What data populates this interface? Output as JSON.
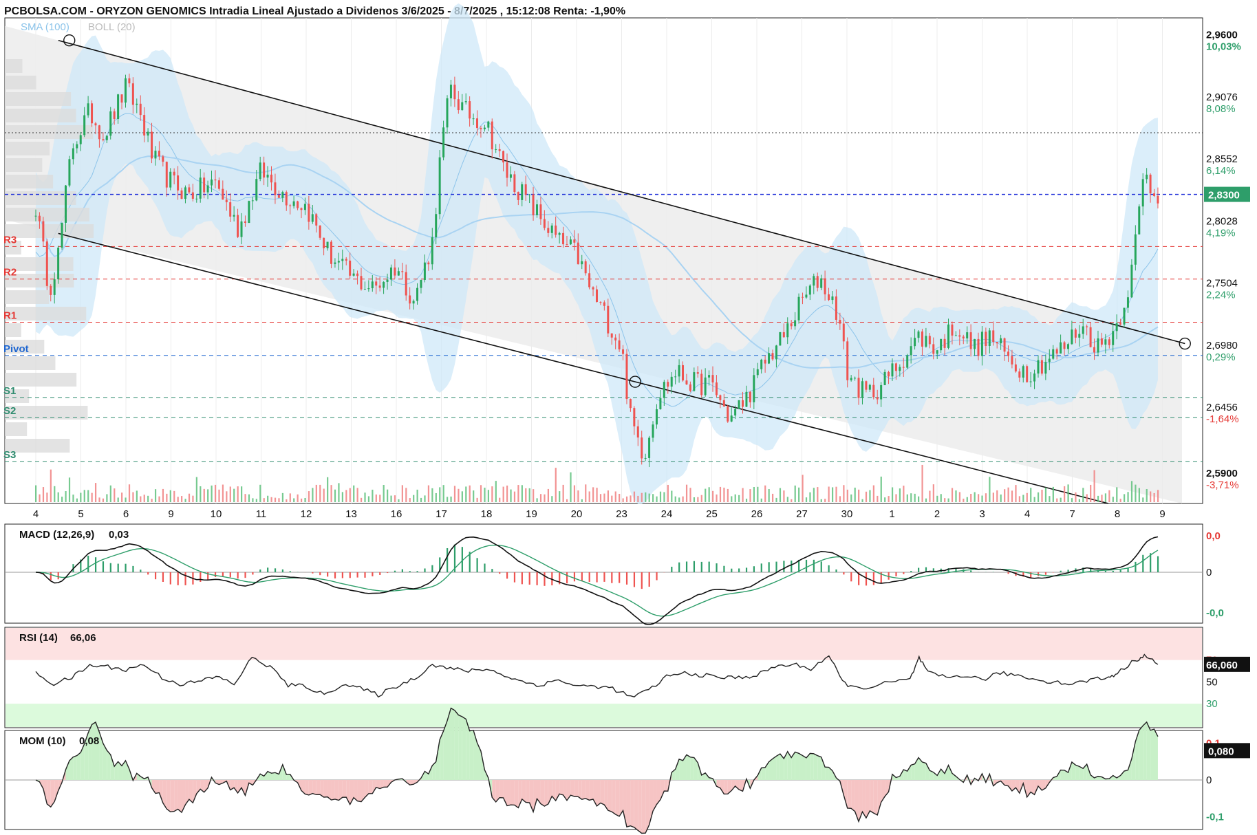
{
  "header": {
    "title": "PCBOLSA.COM - ORYZON GENOMICS Intradia Lineal Ajustado a Dividenos 3/6/2025 - 8/7/2025 , 15:12:08 Renta: -1,90%"
  },
  "indicators_legend": {
    "sma": "SMA (100)",
    "boll": "BOLL (20)"
  },
  "colors": {
    "up": "#26a65b",
    "down": "#ef5350",
    "pivot": "#1e66d0",
    "support": "#2e8b6e",
    "resistance": "#e53935",
    "band": "#cfe8f8",
    "channel": "#e8e8e8"
  },
  "chart_data": [
    {
      "type": "candlestick",
      "name": "main",
      "x_ticks": [
        "4",
        "5",
        "6",
        "9",
        "10",
        "11",
        "12",
        "13",
        "16",
        "17",
        "18",
        "19",
        "20",
        "23",
        "24",
        "25",
        "26",
        "27",
        "30",
        "1",
        "2",
        "3",
        "4",
        "7",
        "8",
        "9"
      ],
      "y_ticks": [
        {
          "value": 2.96,
          "label": "2,9600",
          "pct": "10,03%"
        },
        {
          "value": 2.9076,
          "label": "2,9076",
          "pct": "8,08%"
        },
        {
          "value": 2.8552,
          "label": "2,8552",
          "pct": "6,14%"
        },
        {
          "value": 2.8028,
          "label": "2,8028",
          "pct": "4,19%"
        },
        {
          "value": 2.7504,
          "label": "2,7504",
          "pct": "2,24%"
        },
        {
          "value": 2.698,
          "label": "2,6980",
          "pct": "0,29%"
        },
        {
          "value": 2.6456,
          "label": "2,6456",
          "pct": "-1,64%"
        },
        {
          "value": 2.59,
          "label": "2,5900",
          "pct": "-3,71%"
        }
      ],
      "ylim": [
        2.569,
        2.979
      ],
      "last_price": {
        "value": 2.83,
        "label": "2,8300"
      },
      "pivot_levels": [
        {
          "name": "R3",
          "value": 2.786
        },
        {
          "name": "R2",
          "value": 2.7585
        },
        {
          "name": "R1",
          "value": 2.722
        },
        {
          "name": "Pivot",
          "value": 2.694
        },
        {
          "name": "S1",
          "value": 2.6585
        },
        {
          "name": "S2",
          "value": 2.6415
        },
        {
          "name": "S3",
          "value": 2.6045
        }
      ],
      "reference_line": 2.882,
      "channel": {
        "upper": [
          [
            0.5,
            2.96
          ],
          [
            25.5,
            2.704
          ]
        ],
        "lower": [
          [
            0.5,
            2.797
          ],
          [
            23.8,
            2.569
          ]
        ]
      },
      "price_path": [
        [
          0,
          2.82
        ],
        [
          0.3,
          2.75
        ],
        [
          0.5,
          2.78
        ],
        [
          0.8,
          2.87
        ],
        [
          1.2,
          2.9
        ],
        [
          1.5,
          2.88
        ],
        [
          2.0,
          2.92
        ],
        [
          2.3,
          2.9
        ],
        [
          2.6,
          2.86
        ],
        [
          3.0,
          2.84
        ],
        [
          3.4,
          2.83
        ],
        [
          4.0,
          2.84
        ],
        [
          4.5,
          2.8
        ],
        [
          5.0,
          2.85
        ],
        [
          5.5,
          2.83
        ],
        [
          6.0,
          2.82
        ],
        [
          6.5,
          2.78
        ],
        [
          7.0,
          2.76
        ],
        [
          7.5,
          2.75
        ],
        [
          8.0,
          2.77
        ],
        [
          8.4,
          2.74
        ],
        [
          8.8,
          2.79
        ],
        [
          9.0,
          2.87
        ],
        [
          9.2,
          2.92
        ],
        [
          9.5,
          2.9
        ],
        [
          10.0,
          2.89
        ],
        [
          10.4,
          2.85
        ],
        [
          10.8,
          2.83
        ],
        [
          11.2,
          2.81
        ],
        [
          11.6,
          2.79
        ],
        [
          12.0,
          2.78
        ],
        [
          12.3,
          2.75
        ],
        [
          12.6,
          2.73
        ],
        [
          13.0,
          2.7
        ],
        [
          13.2,
          2.64
        ],
        [
          13.5,
          2.61
        ],
        [
          13.8,
          2.66
        ],
        [
          14.2,
          2.68
        ],
        [
          14.6,
          2.67
        ],
        [
          15.0,
          2.67
        ],
        [
          15.4,
          2.64
        ],
        [
          15.8,
          2.66
        ],
        [
          16.2,
          2.69
        ],
        [
          16.6,
          2.71
        ],
        [
          17.0,
          2.74
        ],
        [
          17.4,
          2.76
        ],
        [
          17.8,
          2.73
        ],
        [
          18.0,
          2.68
        ],
        [
          18.4,
          2.66
        ],
        [
          18.8,
          2.67
        ],
        [
          19.2,
          2.69
        ],
        [
          19.6,
          2.71
        ],
        [
          20.0,
          2.7
        ],
        [
          20.4,
          2.72
        ],
        [
          20.8,
          2.7
        ],
        [
          21.2,
          2.71
        ],
        [
          21.6,
          2.69
        ],
        [
          22.0,
          2.68
        ],
        [
          22.4,
          2.69
        ],
        [
          22.8,
          2.7
        ],
        [
          23.2,
          2.72
        ],
        [
          23.6,
          2.7
        ],
        [
          24.0,
          2.72
        ],
        [
          24.3,
          2.76
        ],
        [
          24.6,
          2.85
        ],
        [
          24.8,
          2.83
        ]
      ]
    },
    {
      "type": "line",
      "name": "MACD",
      "label": "MACD (12,26,9)",
      "value": "0,03",
      "y_ticks": [
        "0,0",
        "0",
        "-0,0"
      ]
    },
    {
      "type": "line",
      "name": "RSI",
      "label": "RSI (14)",
      "value": "66,06",
      "current": {
        "value": 66.06,
        "label": "66,060"
      },
      "y_ticks": [
        {
          "value": 70,
          "label": "70"
        },
        {
          "value": 50,
          "label": "50"
        },
        {
          "value": 30,
          "label": "30"
        }
      ],
      "ylim": [
        8,
        100
      ],
      "points": [
        [
          0,
          58
        ],
        [
          0.4,
          48
        ],
        [
          0.8,
          54
        ],
        [
          1.2,
          65
        ],
        [
          1.6,
          64
        ],
        [
          2.0,
          61
        ],
        [
          2.4,
          66
        ],
        [
          2.8,
          54
        ],
        [
          3.2,
          48
        ],
        [
          3.6,
          50
        ],
        [
          4.0,
          55
        ],
        [
          4.4,
          48
        ],
        [
          4.8,
          72
        ],
        [
          5.2,
          64
        ],
        [
          5.6,
          47
        ],
        [
          6.0,
          46
        ],
        [
          6.4,
          38
        ],
        [
          6.8,
          48
        ],
        [
          7.2,
          44
        ],
        [
          7.6,
          38
        ],
        [
          8.0,
          46
        ],
        [
          8.4,
          53
        ],
        [
          8.8,
          66
        ],
        [
          9.2,
          62
        ],
        [
          9.6,
          60
        ],
        [
          10.0,
          62
        ],
        [
          10.4,
          56
        ],
        [
          10.8,
          50
        ],
        [
          11.2,
          47
        ],
        [
          11.6,
          52
        ],
        [
          12.0,
          46
        ],
        [
          12.4,
          46
        ],
        [
          12.8,
          44
        ],
        [
          13.2,
          36
        ],
        [
          13.6,
          42
        ],
        [
          14.0,
          55
        ],
        [
          14.4,
          58
        ],
        [
          14.8,
          56
        ],
        [
          15.2,
          54
        ],
        [
          15.6,
          54
        ],
        [
          16.0,
          56
        ],
        [
          16.4,
          64
        ],
        [
          16.8,
          66
        ],
        [
          17.2,
          62
        ],
        [
          17.6,
          74
        ],
        [
          17.9,
          50
        ],
        [
          18.2,
          44
        ],
        [
          18.6,
          46
        ],
        [
          19.0,
          50
        ],
        [
          19.4,
          52
        ],
        [
          19.6,
          72
        ],
        [
          19.8,
          58
        ],
        [
          20.2,
          54
        ],
        [
          20.6,
          56
        ],
        [
          21.0,
          52
        ],
        [
          21.4,
          58
        ],
        [
          21.8,
          56
        ],
        [
          22.2,
          52
        ],
        [
          22.6,
          50
        ],
        [
          23.0,
          48
        ],
        [
          23.4,
          52
        ],
        [
          23.8,
          54
        ],
        [
          24.0,
          58
        ],
        [
          24.4,
          70
        ],
        [
          24.6,
          74
        ],
        [
          24.9,
          66
        ]
      ]
    },
    {
      "type": "line",
      "name": "MOM",
      "label": "MOM (10)",
      "value": "0,08",
      "current": {
        "value": 0.08,
        "label": "0,080"
      },
      "y_ticks": [
        {
          "value": 0.1,
          "label": "0,1"
        },
        {
          "value": 0,
          "label": "0"
        },
        {
          "value": -0.1,
          "label": "-0,1"
        }
      ],
      "ylim": [
        -0.135,
        0.135
      ]
    }
  ]
}
